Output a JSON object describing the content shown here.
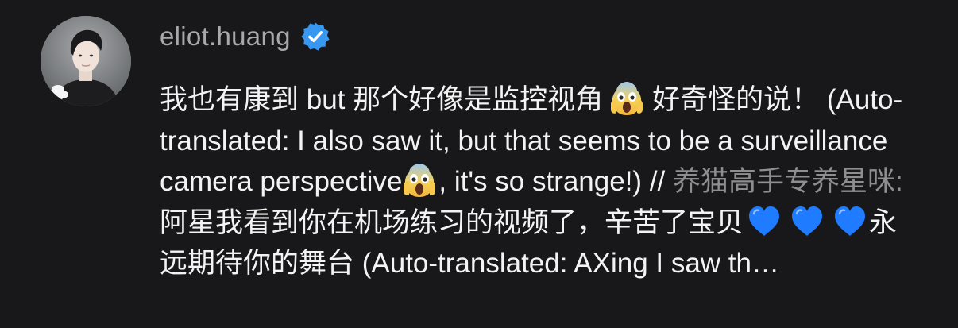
{
  "comment": {
    "username": "eliot.huang",
    "verified": true,
    "body": {
      "part1": "我也有康到 but 那个好像是监控视角",
      "part2": "好奇怪的说！ (Auto-translated: I also saw it, but that seems to be a surveillance camera perspective",
      "part3": ", it's so strange!) // ",
      "reply_handle": "养猫高手专养星咪:",
      "part4": " 阿星我看到你在机场练习的视频了，辛苦了宝贝",
      "part5": "永远期待你的舞台 (Auto-translated: AXing I saw th…"
    },
    "icons": {
      "avatar": "avatar",
      "verified": "verified-badge-icon",
      "scream": "face-screaming-in-fear-emoji",
      "heart": "blue-heart-emoji"
    },
    "colors": {
      "background": "#18181a",
      "text": "#f3f3f3",
      "username": "#a9a9ab",
      "reply_handle": "#8e8e91",
      "verified": "#3897f0",
      "heart": "#1f7bff"
    }
  }
}
